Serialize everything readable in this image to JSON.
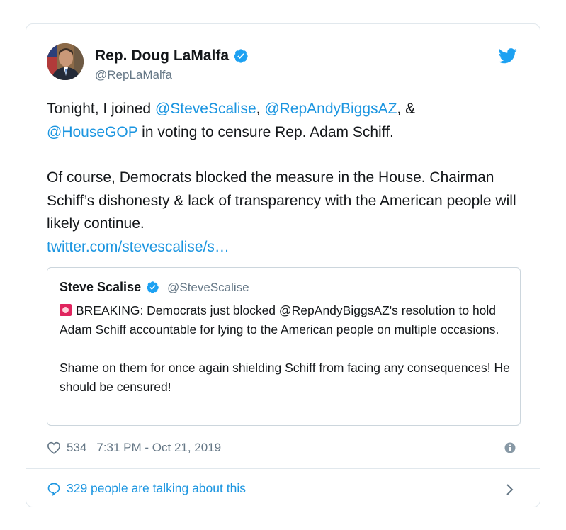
{
  "author": {
    "name": "Rep. Doug LaMalfa",
    "handle": "@RepLaMalfa"
  },
  "tweet": {
    "line1_pre": "Tonight, I joined ",
    "mention1": "@SteveScalise",
    "sep1": ", ",
    "mention2": "@RepAndyBiggsAZ",
    "sep2": ", &",
    "mention3": "@HouseGOP",
    "line2_post": " in voting to censure Rep. Adam Schiff.",
    "para2": "Of course, Democrats blocked the measure in the House. Chairman Schiff’s dishonesty & lack of transparency with the American people will likely continue.",
    "link": "twitter.com/stevescalise/s…"
  },
  "quoted": {
    "name": "Steve Scalise",
    "handle": "@SteveScalise",
    "para1": "BREAKING: Democrats just blocked @RepAndyBiggsAZ's resolution to hold Adam Schiff accountable for lying to the American people on multiple occasions.",
    "para2": "Shame on them for once again shielding Schiff from facing any consequences! He should be censured!"
  },
  "meta": {
    "likes": "534",
    "timestamp": "7:31 PM - Oct 21, 2019"
  },
  "footer": {
    "talking": "329 people are talking about this"
  },
  "icons": {
    "verified": "verified-badge-icon",
    "bird": "twitter-bird-icon",
    "heart": "heart-icon",
    "info": "info-icon",
    "reply": "speech-bubble-icon",
    "chevron": "chevron-right-icon",
    "siren": "rotating-light-emoji-icon"
  },
  "colors": {
    "accent": "#1b95e0",
    "text": "#14171a",
    "muted": "#657786",
    "border": "#e1e8ed"
  }
}
